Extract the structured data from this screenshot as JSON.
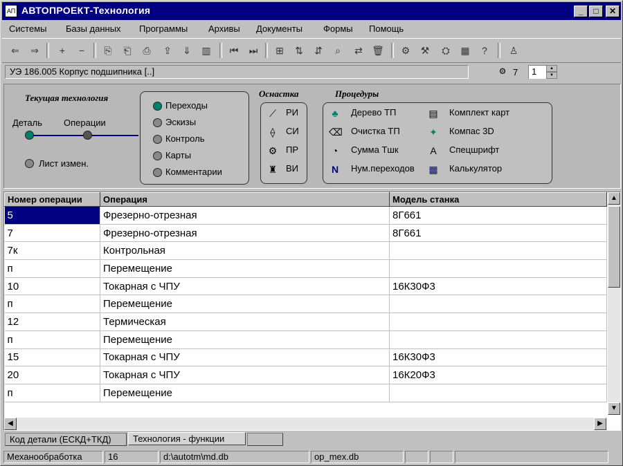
{
  "window": {
    "title": "АВТОПРОЕКТ-Технология",
    "app_icon": "АП"
  },
  "menu": [
    "Системы",
    "Базы данных",
    "Программы",
    "Архивы",
    "Документы",
    "Формы",
    "Помощь"
  ],
  "path": {
    "value": "УЭ 186.005 Корпус подшипника  [..]",
    "counter": "7",
    "spinner": "1"
  },
  "diagram": {
    "current_tech": {
      "title": "Текущая технология",
      "detail": "Деталь",
      "operations": "Операции",
      "change_sheet": "Лист измен."
    },
    "links": [
      "Переходы",
      "Эскизы",
      "Контроль",
      "Карты",
      "Комментарии"
    ],
    "equipment": {
      "title": "Оснастка",
      "items": [
        "РИ",
        "СИ",
        "ПР",
        "ВИ"
      ]
    },
    "procedures": {
      "title": "Процедуры",
      "left": [
        "Дерево ТП",
        "Очистка ТП",
        "Сумма Тшк",
        "Нум.переходов"
      ],
      "right": [
        "Комплект карт",
        "Компас 3D",
        "Спецшрифт",
        "Калькулятор"
      ]
    }
  },
  "grid": {
    "columns": [
      "Номер операции",
      "Операция",
      "Модель станка"
    ],
    "rows": [
      [
        "5",
        "Фрезерно-отрезная",
        "8Г661"
      ],
      [
        "7",
        "Фрезерно-отрезная",
        "8Г661"
      ],
      [
        "7к",
        "Контрольная",
        ""
      ],
      [
        "п",
        "Перемещение",
        ""
      ],
      [
        "10",
        "Токарная с ЧПУ",
        "16К30Ф3"
      ],
      [
        "п",
        "Перемещение",
        ""
      ],
      [
        "12",
        "Термическая",
        ""
      ],
      [
        "п",
        "Перемещение",
        ""
      ],
      [
        "15",
        "Токарная с ЧПУ",
        "16К30Ф3"
      ],
      [
        "20",
        "Токарная с ЧПУ",
        "16К20Ф3"
      ],
      [
        "п",
        "Перемещение",
        ""
      ]
    ]
  },
  "tabs": [
    "Код детали (ЕСКД+ТКД)",
    "Технология - функции"
  ],
  "status": [
    "Механообработка",
    "16",
    "d:\\autotm\\md.db",
    "op_mex.db"
  ]
}
